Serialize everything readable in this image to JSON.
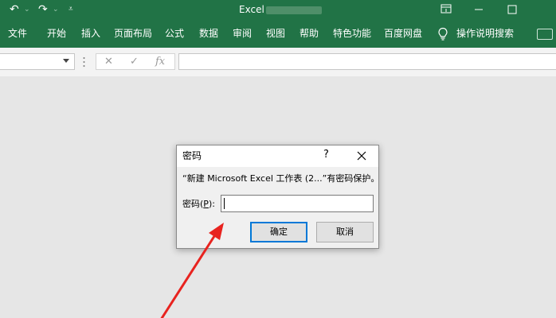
{
  "titlebar": {
    "title": "Excel",
    "undo_icon": "undo-icon",
    "redo_icon": "redo-icon",
    "customize_icon": "dropdown-icon",
    "ribbon_options_icon": "ribbon-display-icon",
    "minimize_icon": "minimize-icon",
    "maximize_icon": "maximize-icon"
  },
  "ribbon": {
    "tabs": [
      "文件",
      "开始",
      "插入",
      "页面布局",
      "公式",
      "数据",
      "审阅",
      "视图",
      "帮助",
      "特色功能",
      "百度网盘"
    ],
    "tell_me": "操作说明搜索"
  },
  "formula_bar": {
    "cancel_symbol": "✕",
    "enter_symbol": "✓",
    "fx_symbol": "fx"
  },
  "dialog": {
    "title": "密码",
    "help": "?",
    "message": "“新建 Microsoft Excel 工作表 (2...”有密码保护。",
    "password_label_prefix": "密码(",
    "password_label_key": "P",
    "password_label_suffix": "):",
    "password_value": "",
    "ok_label": "确定",
    "cancel_label": "取消"
  },
  "colors": {
    "excel_green": "#217346",
    "annotation_arrow": "#e8231f",
    "focus_border": "#0078d7"
  }
}
